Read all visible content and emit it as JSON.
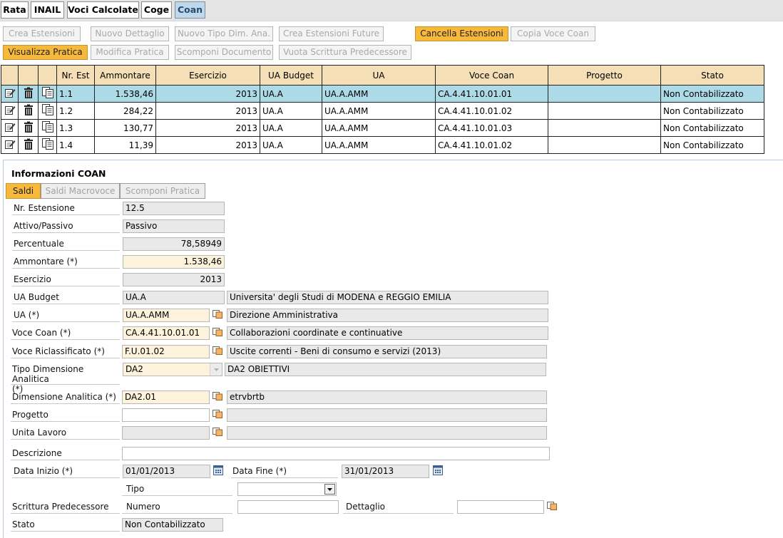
{
  "tabs": [
    "Rata",
    "INAIL",
    "Voci Calcolate",
    "Coge",
    "Coan"
  ],
  "toolbar": {
    "row1": [
      "Crea Estensioni",
      "Nuovo Dettaglio",
      "Nuovo Tipo Dim. Ana.",
      "Crea Estensioni Future",
      "Cancella Estensioni",
      "Copia Voce Coan"
    ],
    "row2": [
      "Visualizza Pratica",
      "Modifica Pratica",
      "Scomponi Documento",
      "Vuota Scrittura Predecessore"
    ]
  },
  "grid": {
    "headers": [
      "Nr. Est",
      "Ammontare",
      "Esercizio",
      "UA Budget",
      "UA",
      "Voce Coan",
      "Progetto",
      "Stato"
    ],
    "rows": [
      [
        "1.1",
        "1.538,46",
        "2013",
        "UA.A",
        "UA.A.AMM",
        "CA.4.41.10.01.01",
        "",
        "Non Contabilizzato"
      ],
      [
        "1.2",
        "284,22",
        "2013",
        "UA.A",
        "UA.A.AMM",
        "CA.4.41.10.01.02",
        "",
        "Non Contabilizzato"
      ],
      [
        "1.3",
        "130,77",
        "2013",
        "UA.A",
        "UA.A.AMM",
        "CA.4.41.10.01.03",
        "",
        "Non Contabilizzato"
      ],
      [
        "1.4",
        "11,39",
        "2013",
        "UA.A",
        "UA.A.AMM",
        "CA.4.41.10.01.02",
        "",
        "Non Contabilizzato"
      ]
    ],
    "selected_row": 0
  },
  "info": {
    "title": "Informazioni COAN",
    "subtabs": [
      "Saldi",
      "Saldi Macrovoce",
      "Scomponi Pratica"
    ],
    "labels": {
      "nr_estensione": "Nr. Estensione",
      "attivo_passivo": "Attivo/Passivo",
      "percentuale": "Percentuale",
      "ammontare": "Ammontare (*)",
      "esercizio": "Esercizio",
      "ua_budget": "UA Budget",
      "ua": "UA (*)",
      "voce_coan": "Voce Coan (*)",
      "voce_riclassificato": "Voce Riclassificato (*)",
      "tipo_dimensione_1": "Tipo Dimensione Analitica",
      "tipo_dimensione_2": "(*)",
      "dimensione_analitica": "Dimensione Analitica (*)",
      "progetto": "Progetto",
      "unita_lavoro": "Unita Lavoro",
      "descrizione": "Descrizione",
      "data_inizio": "Data Inizio (*)",
      "data_fine": "Data Fine (*)",
      "tipo": "Tipo",
      "scrittura_predecessore": "Scrittura Predecessore",
      "numero": "Numero",
      "dettaglio": "Dettaglio",
      "stato": "Stato"
    },
    "values": {
      "nr_estensione": "12.5",
      "attivo_passivo": "Passivo",
      "percentuale": "78,58949",
      "ammontare": "1.538,46",
      "esercizio": "2013",
      "ua_budget": "UA.A",
      "ua_budget_desc": "Universita' degli Studi di MODENA e REGGIO EMILIA",
      "ua": "UA.A.AMM",
      "ua_desc": "Direzione Amministrativa",
      "voce_coan": "CA.4.41.10.01.01",
      "voce_coan_desc": "Collaborazioni coordinate e continuative",
      "voce_riclassificato": "F.U.01.02",
      "voce_riclassificato_desc": "Uscite correnti - Beni di consumo e servizi (2013)",
      "tipo_dimensione": "DA2",
      "tipo_dimensione_desc": "DA2 OBIETTIVI",
      "dimensione_analitica": "DA2.01",
      "dimensione_analitica_desc": "etrvbrtb",
      "progetto": "",
      "progetto_desc": "",
      "unita_lavoro": "",
      "unita_lavoro_desc": "",
      "descrizione": "",
      "data_inizio": "01/01/2013",
      "data_fine": "31/01/2013",
      "tipo": "",
      "numero": "",
      "dettaglio": "",
      "stato": "Non Contabilizzato"
    }
  },
  "colors": {
    "tab_active": "#bcd9f0",
    "button_orange": "#f7b93c",
    "grid_header": "#f5dfb6",
    "row_selected": "#acdae7",
    "required_field": "#fdf2db"
  }
}
